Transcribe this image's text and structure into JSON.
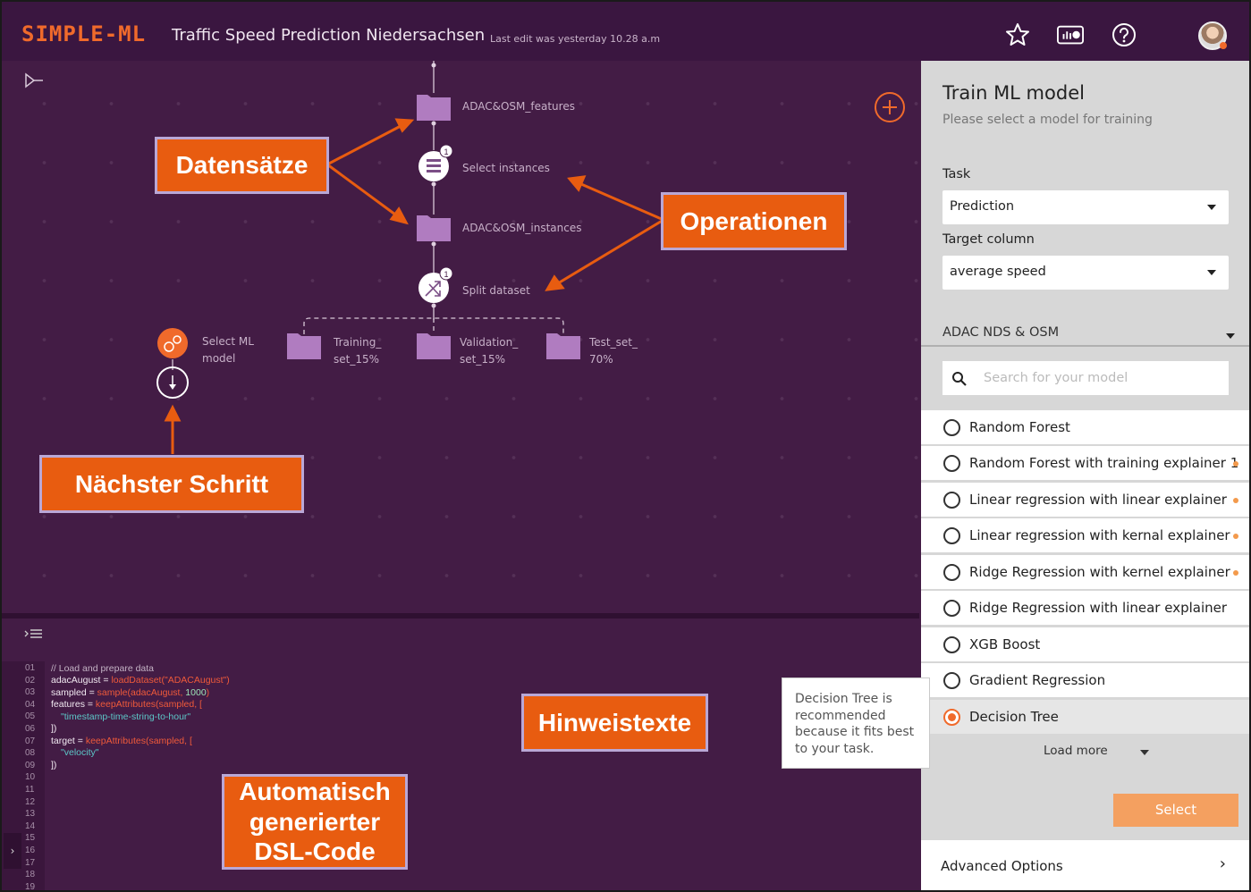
{
  "header": {
    "logo": "SIMPLE-ML",
    "project_title": "Traffic Speed Prediction Niedersachsen",
    "last_edit": "Last edit was yesterday 10.28 a.m"
  },
  "workflow": {
    "nodes": [
      {
        "label": "ADAC&OSM_features"
      },
      {
        "label": "Select instances",
        "badge": "1"
      },
      {
        "label": "ADAC&OSM_instances"
      },
      {
        "label": "Split dataset",
        "badge": "1"
      },
      {
        "label": "Training_\nset_15%"
      },
      {
        "label": "Validation_\nset_15%"
      },
      {
        "label": "Test_set_\n70%"
      },
      {
        "label": "Select ML\nmodel"
      }
    ]
  },
  "code_editor": {
    "line_numbers": [
      "01",
      "02",
      "03",
      "04",
      "05",
      "06",
      "07",
      "08",
      "09",
      "10",
      "11",
      "12",
      "13",
      "14",
      "15",
      "16",
      "17",
      "18",
      "19"
    ],
    "lines": {
      "l1": "// Load and prepare data",
      "l2a": "adacAugust = ",
      "l2b": "loadDataset(\"ADACAugust\")",
      "l3a": "sampled = ",
      "l3b": "sample(adacAugust, ",
      "l3c": "1000",
      "l3d": ")",
      "l4a": "features = ",
      "l4b": "keepAttributes(sampled, [",
      "l5": "\"timestamp-time-string-to-hour\"",
      "l6": "])",
      "l7a": "target = ",
      "l7b": "keepAttributes(sampled, [",
      "l8": "\"velocity\"",
      "l9": "])"
    }
  },
  "annotations": {
    "datensaetze": "Datensätze",
    "operationen": "Operationen",
    "naechster_schritt": "Nächster Schritt",
    "hinweistexte": "Hinweistexte",
    "dsl_code": "Automatisch generierter DSL-Code"
  },
  "panel": {
    "title": "Train ML model",
    "subtitle": "Please select a model for training",
    "task_label": "Task",
    "task_value": "Prediction",
    "target_label": "Target column",
    "target_value": "average speed",
    "dataset": "ADAC NDS & OSM",
    "search_placeholder": "Search for your model",
    "models": [
      {
        "label": "Random Forest",
        "hint": false,
        "selected": false
      },
      {
        "label": "Random Forest with training explainer 1",
        "hint": true,
        "selected": false
      },
      {
        "label": "Linear regression with linear explainer",
        "hint": true,
        "selected": false
      },
      {
        "label": "Linear regression with kernal explainer",
        "hint": true,
        "selected": false
      },
      {
        "label": "Ridge Regression with kernel explainer",
        "hint": true,
        "selected": false
      },
      {
        "label": "Ridge Regression with linear explainer",
        "hint": false,
        "selected": false
      },
      {
        "label": "XGB Boost",
        "hint": false,
        "selected": false
      },
      {
        "label": "Gradient Regression",
        "hint": false,
        "selected": false
      },
      {
        "label": "Decision Tree",
        "hint": false,
        "selected": true
      }
    ],
    "load_more": "Load more",
    "select_button": "Select",
    "advanced_options": "Advanced Options",
    "tooltip": "Decision Tree is recommended because it fits best to your task."
  },
  "colors": {
    "accent": "#f06a2b",
    "canvas_bg": "#431c45",
    "node_purple": "#b07cc0",
    "callout_bg": "#e85c10"
  }
}
